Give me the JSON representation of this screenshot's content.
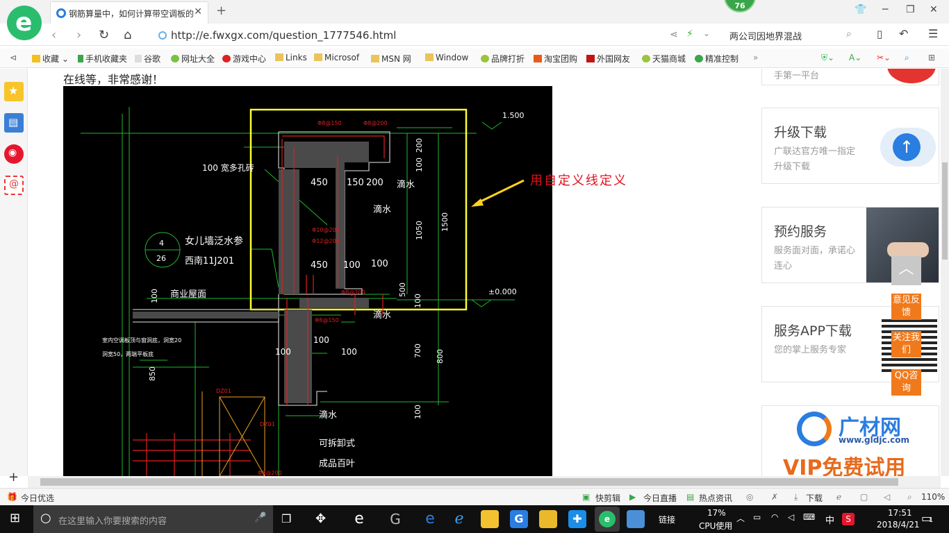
{
  "browser": {
    "tab_title": "钢筋算量中，如何计算带空调板的女儿墙",
    "badge": "76",
    "url": "http://e.fwxgx.com/question_1777546.html",
    "search_text": "两公司因地界混战"
  },
  "favorites": [
    "收藏",
    "手机收藏夹",
    "谷歌",
    "网址大全",
    "游戏中心",
    "Links",
    "Microsof",
    "MSN 网",
    "Window",
    "品牌打折",
    "淘宝团购",
    "外国网友",
    "天猫商城",
    "精准控制"
  ],
  "page": {
    "intro": "在线等，非常感谢！",
    "annotation": "用自定义线定义",
    "cad_labels": {
      "elev_top": "1.500",
      "elev_zero": "±0.000",
      "d450a": "450",
      "d150": "150",
      "d200": "200",
      "d450b": "450",
      "d100a": "100",
      "d100b": "100",
      "drip1": "滴水",
      "drip2": "滴水",
      "drip3": "滴水",
      "drip4": "滴水",
      "brick": "100 宽多孔砖",
      "parapet": "女儿墙泛水参",
      "atlas": "西南11J201",
      "circle_top": "4",
      "circle_bot": "26",
      "roof": "商业屋面",
      "h100": "100",
      "v200": "200",
      "v100": "100",
      "v1050": "1050",
      "v1500": "1500",
      "v500": "500",
      "v100b": "100",
      "v700": "700",
      "v800": "800",
      "v100c": "100",
      "d100c": "100",
      "d100d": "100",
      "d100e": "100",
      "v850": "850",
      "shutter1": "可拆卸式",
      "shutter2": "成品百叶",
      "note1": "室内空调板顶与窗洞底，洞宽20",
      "note2": "洞宽50，两端平板底",
      "dz1": "DZ01",
      "dz2": "DZ01",
      "rebar1": "Φ8@150",
      "rebar2": "Φ8@200",
      "rebar3": "Φ10@200",
      "rebar4": "Φ12@200",
      "rebar5": "Φ8@150",
      "rebar6": "Φ8@200",
      "rebar7": "Φ8@200"
    },
    "cards": [
      {
        "title": "升级下载",
        "sub": "广联达官方唯一指定升级下载"
      },
      {
        "title": "预约服务",
        "sub": "服务面对面，承诺心连心"
      },
      {
        "title": "服务APP下载",
        "sub": "您的掌上服务专家"
      }
    ],
    "card_top_sub": "手第一平台",
    "float_buttons": [
      "意见反馈",
      "关注我们",
      "QQ咨询"
    ],
    "ad": {
      "brand": "广材网",
      "site": "www.gldjc.com",
      "vip": "VIP免费试用"
    }
  },
  "statusbar": {
    "left": "今日优选",
    "items": [
      "快剪辑",
      "今日直播",
      "热点资讯",
      "下载"
    ],
    "zoom": "110%"
  },
  "taskbar": {
    "search_placeholder": "在这里输入你要搜索的内容",
    "link_label": "链接",
    "cpu_pct": "17%",
    "cpu_label": "CPU使用",
    "ime": "中",
    "time": "17:51",
    "date": "2018/4/21",
    "notif": "1"
  }
}
